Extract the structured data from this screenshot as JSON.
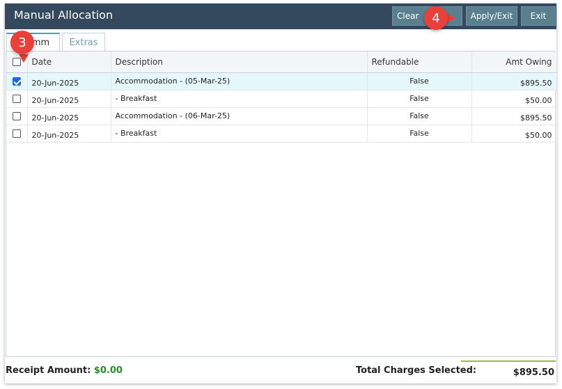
{
  "window": {
    "title": "Manual Allocation",
    "buttons": {
      "clear": "Clear",
      "apply_exit": "Apply/Exit",
      "exit": "Exit"
    }
  },
  "tabs": [
    {
      "label": "mm",
      "active": true
    },
    {
      "label": "Extras",
      "active": false
    }
  ],
  "grid": {
    "columns": [
      "Date",
      "Description",
      "Refundable",
      "Amt Owing"
    ],
    "rows": [
      {
        "checked": true,
        "date": "20-Jun-2025",
        "description": "Accommodation - (05-Mar-25)",
        "refundable": "False",
        "amt_owing": "$895.50"
      },
      {
        "checked": false,
        "date": "20-Jun-2025",
        "description": "- Breakfast",
        "refundable": "False",
        "amt_owing": "$50.00"
      },
      {
        "checked": false,
        "date": "20-Jun-2025",
        "description": "Accommodation - (06-Mar-25)",
        "refundable": "False",
        "amt_owing": "$895.50"
      },
      {
        "checked": false,
        "date": "20-Jun-2025",
        "description": "- Breakfast",
        "refundable": "False",
        "amt_owing": "$50.00"
      }
    ]
  },
  "footer": {
    "receipt_label": "Receipt Amount:",
    "receipt_value": "$0.00",
    "total_label": "Total Charges Selected:",
    "total_value": "$895.50"
  },
  "markers": {
    "step3": "3",
    "step4": "4"
  },
  "colors": {
    "titlebar": "#34495e",
    "button": "#5a7f8f",
    "selected_row": "#e6f7fb",
    "receipt_green": "#2e8b2e",
    "marker_red": "#e8403a"
  }
}
